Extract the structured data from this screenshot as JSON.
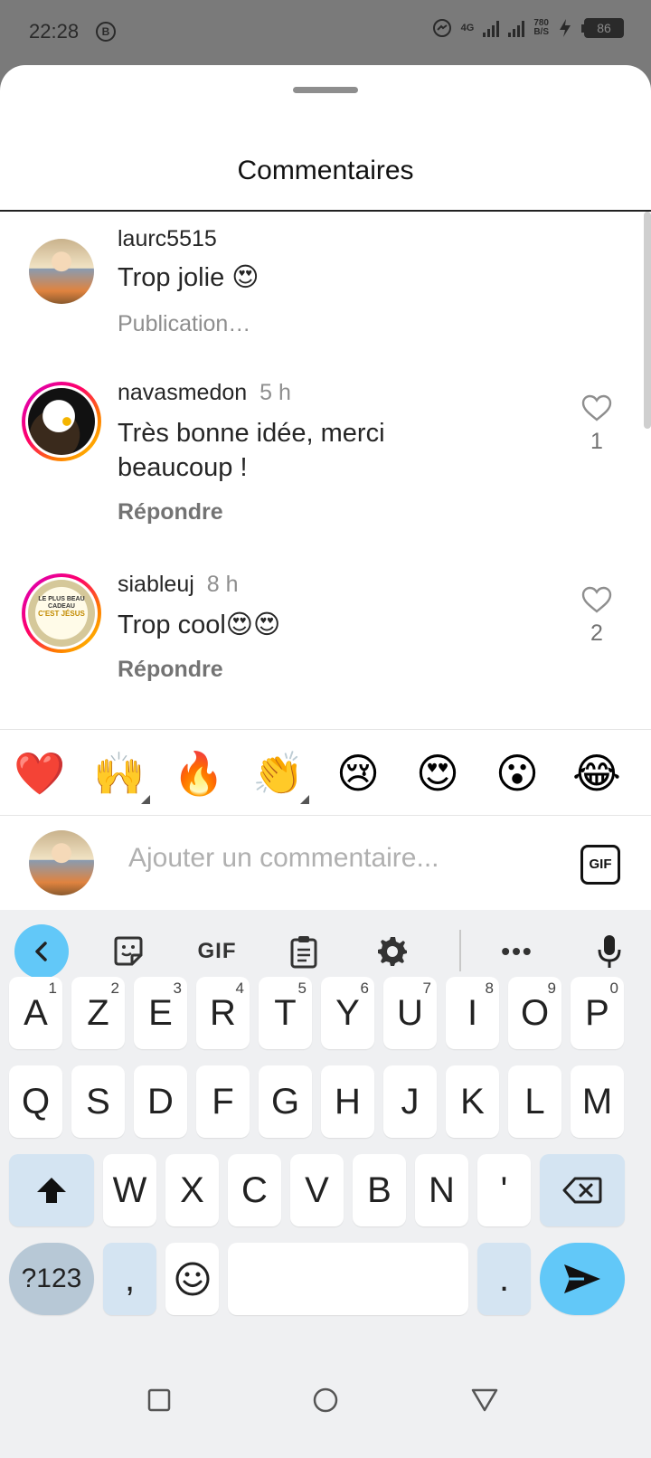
{
  "status_bar": {
    "time": "22:28",
    "b_badge": "B",
    "network": "4G",
    "speed_value": "780",
    "speed_unit": "B/S",
    "battery": "86"
  },
  "sheet": {
    "title": "Commentaires"
  },
  "comments": [
    {
      "username": "laurc5515",
      "time": "",
      "text": "Trop jolie 😍",
      "subtext": "Publication…",
      "likes": ""
    },
    {
      "username": "navasmedon",
      "time": "5 h",
      "text": "Très bonne idée, merci beaucoup !",
      "subtext": "Répondre",
      "likes": "1"
    },
    {
      "username": "siableuj",
      "time": "8 h",
      "text": "Trop cool😍😍",
      "subtext": "Répondre",
      "likes": "2"
    }
  ],
  "avatar_book_text": {
    "line1": "LE PLUS BEAU CADEAU",
    "line2": "C'EST JÉSUS"
  },
  "emoji_bar": [
    "❤️",
    "🙌",
    "🔥",
    "👏",
    "😢",
    "😍",
    "😮",
    "😂"
  ],
  "composer": {
    "placeholder": "Ajouter un commentaire...",
    "gif_label": "GIF"
  },
  "keyboard": {
    "toolbar_gif": "GIF",
    "toolbar_more": "•••",
    "row1": [
      {
        "key": "A",
        "hint": "1"
      },
      {
        "key": "Z",
        "hint": "2"
      },
      {
        "key": "E",
        "hint": "3"
      },
      {
        "key": "R",
        "hint": "4"
      },
      {
        "key": "T",
        "hint": "5"
      },
      {
        "key": "Y",
        "hint": "6"
      },
      {
        "key": "U",
        "hint": "7"
      },
      {
        "key": "I",
        "hint": "8"
      },
      {
        "key": "O",
        "hint": "9"
      },
      {
        "key": "P",
        "hint": "0"
      }
    ],
    "row2": [
      "Q",
      "S",
      "D",
      "F",
      "G",
      "H",
      "J",
      "K",
      "L",
      "M"
    ],
    "row3": [
      "W",
      "X",
      "C",
      "V",
      "B",
      "N",
      "'"
    ],
    "bottom": {
      "numbers": "?123",
      "comma": ",",
      "period": "."
    }
  }
}
